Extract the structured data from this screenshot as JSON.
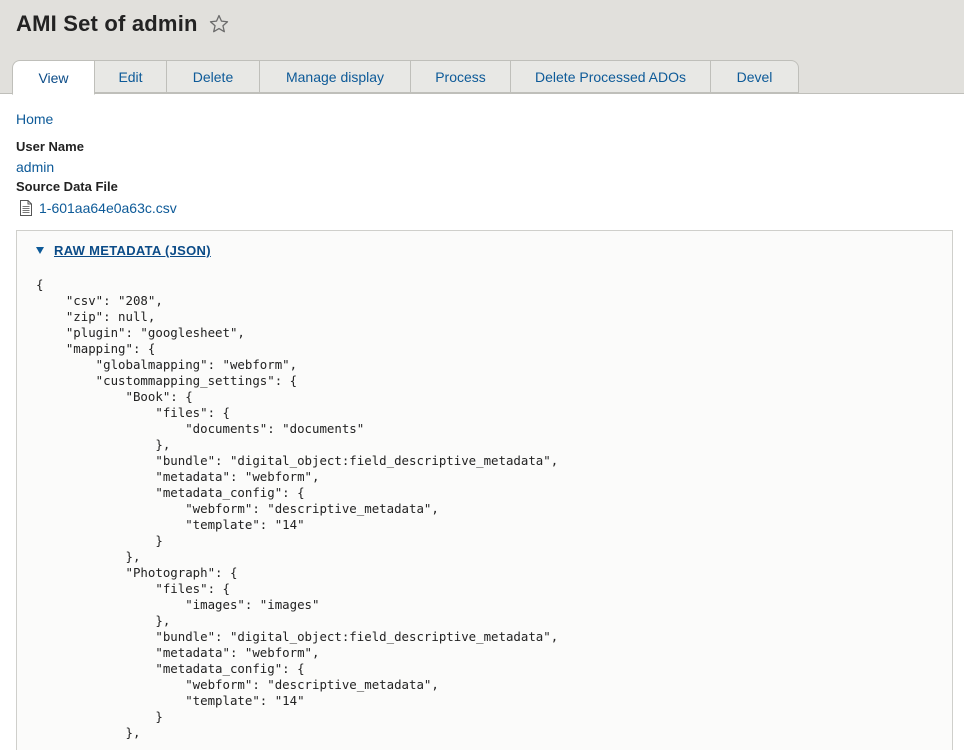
{
  "page": {
    "title": "AMI Set of admin"
  },
  "tabs": [
    {
      "label": "View"
    },
    {
      "label": "Edit"
    },
    {
      "label": "Delete"
    },
    {
      "label": "Manage display"
    },
    {
      "label": "Process"
    },
    {
      "label": "Delete Processed ADOs"
    },
    {
      "label": "Devel"
    }
  ],
  "breadcrumb": {
    "home": "Home"
  },
  "fields": {
    "user_name_label": "User Name",
    "user_name_value": "admin",
    "source_file_label": "Source Data File",
    "source_file_value": "1-601aa64e0a63c.csv"
  },
  "raw_metadata": {
    "summary": "RAW METADATA (JSON)",
    "json_text": "{\n    \"csv\": \"208\",\n    \"zip\": null,\n    \"plugin\": \"googlesheet\",\n    \"mapping\": {\n        \"globalmapping\": \"webform\",\n        \"custommapping_settings\": {\n            \"Book\": {\n                \"files\": {\n                    \"documents\": \"documents\"\n                },\n                \"bundle\": \"digital_object:field_descriptive_metadata\",\n                \"metadata\": \"webform\",\n                \"metadata_config\": {\n                    \"webform\": \"descriptive_metadata\",\n                    \"template\": \"14\"\n                }\n            },\n            \"Photograph\": {\n                \"files\": {\n                    \"images\": \"images\"\n                },\n                \"bundle\": \"digital_object:field_descriptive_metadata\",\n                \"metadata\": \"webform\",\n                \"metadata_config\": {\n                    \"webform\": \"descriptive_metadata\",\n                    \"template\": \"14\"\n                }\n            },"
  },
  "icons": {
    "favorite": "star-icon",
    "file": "file-icon",
    "toggle": "triangle-down-icon"
  },
  "colors": {
    "link": "#0d5a98",
    "header_bg": "#e1e0dc"
  }
}
